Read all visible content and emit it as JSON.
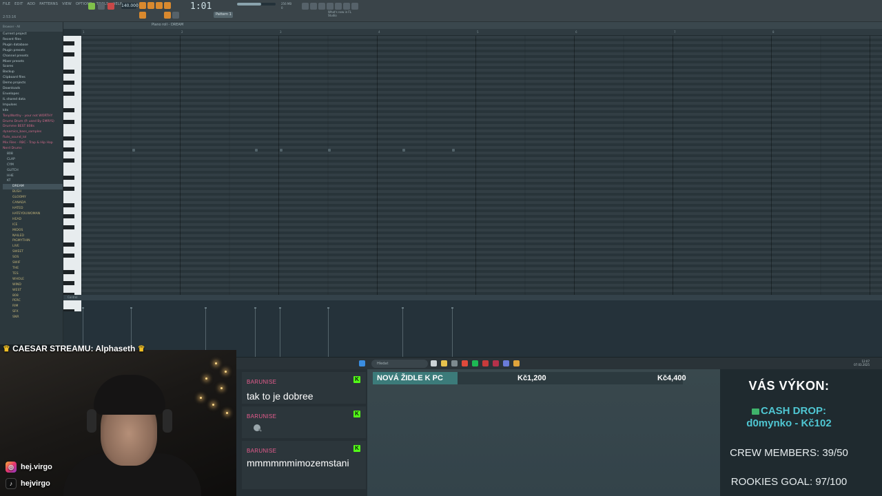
{
  "fl_studio": {
    "menu": [
      "FILE",
      "EDIT",
      "ADD",
      "PATTERNS",
      "VIEW",
      "OPTIONS",
      "TOOLS",
      "HELP"
    ],
    "clock_top": "2:53:16",
    "tempo": "140.000",
    "time_display": "1:01",
    "time_sub": ":00",
    "pattern": "Pattern 1",
    "cpu_readout": [
      "256 MB",
      "0"
    ],
    "hint": [
      "What's new in FL",
      "Studio"
    ],
    "piano_roll_title": "Piano roll - DREAM",
    "control_label": "Control",
    "volume_level": 0.62,
    "ruler": [
      "1",
      "2",
      "3",
      "4",
      "5",
      "6",
      "7",
      "8"
    ],
    "browser": {
      "header": "Browser - All",
      "folders": [
        "Current project",
        "Recent files",
        "Plugin database",
        "Plugin presets",
        "Channel presets",
        "Mixer presets",
        "Scores",
        "Backup",
        "Clipboard files",
        "Demo projects",
        "Downloads",
        "Envelopes",
        "IL shared data",
        "Impulses",
        "kits"
      ],
      "items": [
        "TonyWorthy - your not WORTHY",
        "Drums Drum (P. used By EMRYS)",
        "Drumme BEST 808s",
        "dynamics_bass_samples",
        "flute_sound_lol",
        "Mix Files - RBC - Trap & Hip Hop",
        "Nerd Drums"
      ],
      "kits": [
        "808",
        "CLAP",
        "CYM",
        "GLITCH",
        "HHE",
        "KT"
      ],
      "subs": [
        "DREAM",
        "BUSH",
        "GLOOMY",
        "CANADA",
        "HATED",
        "HATEYOUWOMAN",
        "HEAD",
        "ICE",
        "MIDOS",
        "NAILED",
        "PIGMYTHIN",
        "LIVE",
        "SWEET",
        "SOS",
        "SWIF",
        "THE",
        "TES",
        "WHOLE",
        "WIND",
        "WEST",
        "808",
        "PERC",
        "RIM",
        "SFX",
        "SNR"
      ]
    }
  },
  "taskbar": {
    "search_placeholder": "Hledat",
    "tray_time": "12:07",
    "tray_date": "07.03.2025"
  },
  "overlay": {
    "banner": "CAESAR STREAMU: Alphaseth",
    "crown_glyph": "♛",
    "instagram": "hej.virgo",
    "tiktok": "hejvirgo"
  },
  "chat": {
    "messages": [
      {
        "user": "BARUNISE",
        "text": "tak to je dobree"
      },
      {
        "user": "BARUNISE",
        "text": ""
      },
      {
        "user": "BARUNISE",
        "text": "mmmmmmimozemstani"
      }
    ],
    "badge": "K"
  },
  "goal": {
    "title": "NOVÁ ŽIDLE K PC",
    "current": "Kč1,200",
    "target": "Kč4,400",
    "progress": 0.2727
  },
  "stats": {
    "title": "VÁS VÝKON:",
    "cash_label": "CASH DROP:",
    "cash_value": "d0mynko - Kč102",
    "crew": "CREW MEMBERS: 39/50",
    "rookies": "ROOKIES GOAL: 97/100"
  },
  "colors": {
    "accent_orange": "#d9892e",
    "kick_green": "#53fc18",
    "chat_user": "#e85c8e",
    "cash_teal": "#4fc6d2",
    "goal_fill": "#3c7b7a"
  }
}
